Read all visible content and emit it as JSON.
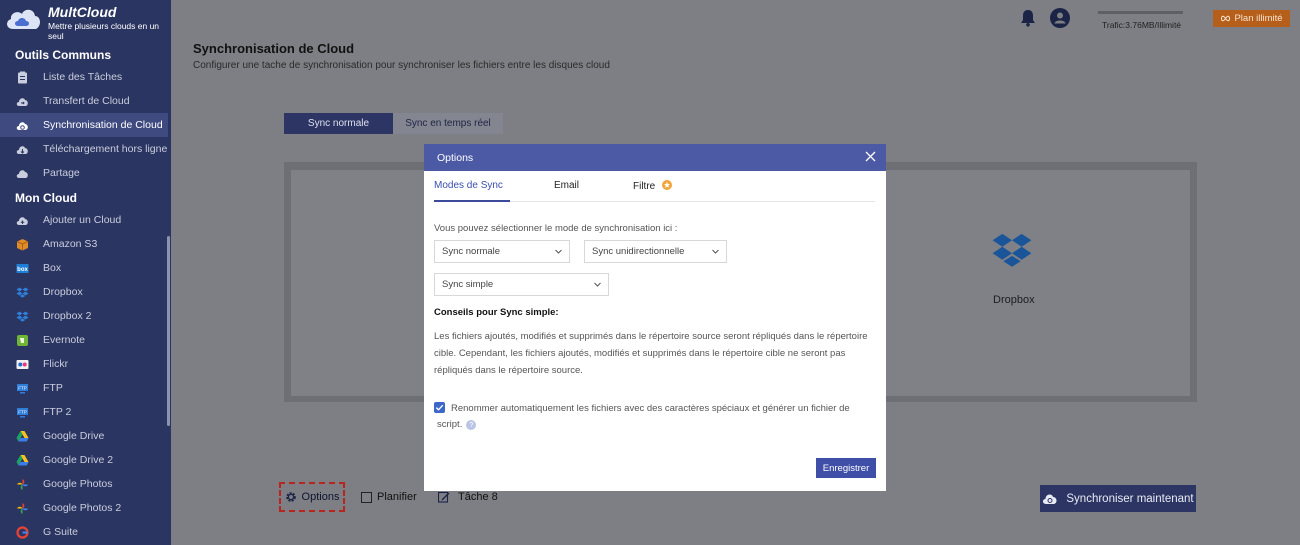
{
  "app": {
    "name": "MultCloud",
    "tagline": "Mettre plusieurs clouds en un seul"
  },
  "sidebar": {
    "section1": "Outils Communs",
    "tools": [
      {
        "label": "Liste des Tâches",
        "icon": "clipboard-icon"
      },
      {
        "label": "Transfert de Cloud",
        "icon": "cloud-transfer-icon"
      },
      {
        "label": "Synchronisation de Cloud",
        "icon": "cloud-sync-icon"
      },
      {
        "label": "Téléchargement hors ligne",
        "icon": "cloud-download-icon"
      },
      {
        "label": "Partage",
        "icon": "share-icon"
      }
    ],
    "section2": "Mon Cloud",
    "clouds": [
      {
        "label": "Ajouter un Cloud",
        "icon": "add-cloud-icon"
      },
      {
        "label": "Amazon S3",
        "icon": "amazon-s3-icon"
      },
      {
        "label": "Box",
        "icon": "box-icon"
      },
      {
        "label": "Dropbox",
        "icon": "dropbox-icon"
      },
      {
        "label": "Dropbox 2",
        "icon": "dropbox-icon"
      },
      {
        "label": "Evernote",
        "icon": "evernote-icon"
      },
      {
        "label": "Flickr",
        "icon": "flickr-icon"
      },
      {
        "label": "FTP",
        "icon": "ftp-icon"
      },
      {
        "label": "FTP 2",
        "icon": "ftp-icon"
      },
      {
        "label": "Google Drive",
        "icon": "google-drive-icon"
      },
      {
        "label": "Google Drive 2",
        "icon": "google-drive-icon"
      },
      {
        "label": "Google Photos",
        "icon": "google-photos-icon"
      },
      {
        "label": "Google Photos 2",
        "icon": "google-photos-icon"
      },
      {
        "label": "G Suite",
        "icon": "g-suite-icon"
      }
    ]
  },
  "header": {
    "traffic": "Trafic:3.76MB/Illimité",
    "plan": "Plan illimité"
  },
  "main": {
    "title": "Synchronisation de Cloud",
    "subtitle": "Configurer une tache de synchronisation pour synchroniser les fichiers entre les disques cloud",
    "tab_normal": "Sync normale",
    "tab_realtime": "Sync en temps réel",
    "target_label": "Dropbox",
    "options": "Options",
    "schedule": "Planifier",
    "task": "Tâche 8",
    "sync_now": "Synchroniser maintenant"
  },
  "modal": {
    "title": "Options",
    "tabs": [
      "Modes de Sync",
      "Email",
      "Filtre"
    ],
    "intro": "Vous pouvez sélectionner le mode de synchronisation ici :",
    "select1": "Sync normale",
    "select2": "Sync unidirectionnelle",
    "select3": "Sync simple",
    "tips_title": "Conseils pour Sync simple:",
    "tips_text": "Les fichiers ajoutés, modifiés et supprimés dans le répertoire source seront répliqués dans le répertoire cible. Cependant, les fichiers ajoutés, modifiés et supprimés dans le répertoire cible ne seront pas répliqués dans le répertoire source.",
    "rename_text": "Renommer automatiquement les fichiers avec des caractères spéciaux et générer un fichier de script.",
    "save": "Enregistrer"
  },
  "colors": {
    "sidebar": "#2b3561",
    "modal_header": "#4c5aa6",
    "accent": "#3f4ea6",
    "plan": "#b55f1a"
  }
}
